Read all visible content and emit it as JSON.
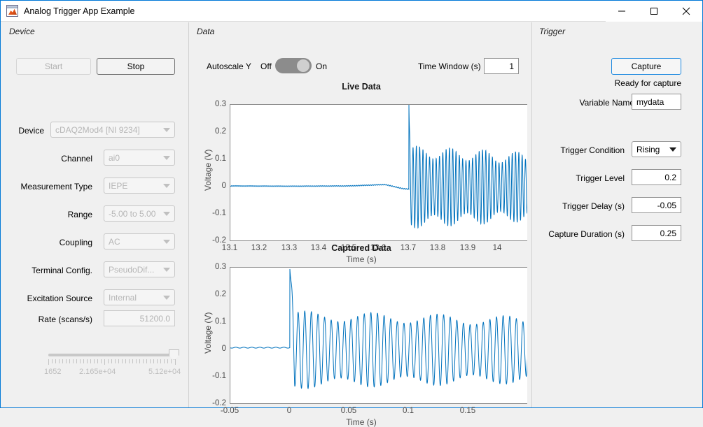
{
  "window": {
    "title": "Analog Trigger App Example",
    "icon": "matlab-app-icon",
    "minimize": "minimize-icon",
    "maximize": "maximize-icon",
    "close": "close-icon"
  },
  "device_panel": {
    "title": "Device",
    "start_label": "Start",
    "stop_label": "Stop",
    "fields": [
      {
        "label": "Device",
        "value": "cDAQ2Mod4 [NI 9234]"
      },
      {
        "label": "Channel",
        "value": "ai0"
      },
      {
        "label": "Measurement Type",
        "value": "IEPE"
      },
      {
        "label": "Range",
        "value": "-5.00 to 5.00"
      },
      {
        "label": "Coupling",
        "value": "AC"
      },
      {
        "label": "Terminal Config.",
        "value": "PseudoDif..."
      },
      {
        "label": "Excitation Source",
        "value": "Internal"
      }
    ],
    "rate_label": "Rate (scans/s)",
    "rate_value": "51200.0",
    "slider_ticks": [
      "1652",
      "2.165e+04",
      "5.12e+04"
    ]
  },
  "data_panel": {
    "title": "Data",
    "autoscale_label": "Autoscale Y",
    "autoscale_off": "Off",
    "autoscale_on": "On",
    "autoscale_state": "On",
    "time_window_label": "Time Window (s)",
    "time_window_value": "1"
  },
  "trigger_panel": {
    "title": "Trigger",
    "capture_label": "Capture",
    "status": "Ready for capture",
    "variable_name_label": "Variable Name",
    "variable_name_value": "mydata",
    "condition_label": "Trigger Condition",
    "condition_value": "Rising",
    "level_label": "Trigger Level",
    "level_value": "0.2",
    "delay_label": "Trigger Delay (s)",
    "delay_value": "-0.05",
    "duration_label": "Capture Duration (s)",
    "duration_value": "0.25"
  },
  "colors": {
    "accent": "#0072bd",
    "focus": "#1f8ae0",
    "panel_bg": "#f0f0f0"
  },
  "chart_data": [
    {
      "type": "line",
      "name": "live-data",
      "title": "Live Data",
      "xlabel": "Time (s)",
      "ylabel": "Voltage (V)",
      "xlim": [
        13.1,
        14.1
      ],
      "ylim": [
        -0.2,
        0.3
      ],
      "xticks": [
        13.1,
        13.2,
        13.3,
        13.4,
        13.5,
        13.6,
        13.7,
        13.8,
        13.9,
        14
      ],
      "xticklabels": [
        "13.1",
        "13.2",
        "13.3",
        "13.4",
        "13.5",
        "13.6",
        "13.7",
        "13.8",
        "13.9",
        "14"
      ],
      "yticks": [
        -0.2,
        -0.1,
        0,
        0.1,
        0.2,
        0.3
      ],
      "yticklabels": [
        "-0.2",
        "-0.1",
        "0",
        "0.1",
        "0.2",
        "0.3"
      ],
      "grid": false,
      "color": "#0072bd",
      "trigger_time": 13.7,
      "spike_value": 0.3,
      "baseline": 0.005,
      "oscillation": {
        "frequency_hz": 90,
        "amplitude_start": 0.13,
        "amplitude_end": 0.105,
        "beat_frequency_hz": 9,
        "beat_depth": 0.022
      },
      "pre_trigger_drift": [
        {
          "t": 13.1,
          "v": 0.004
        },
        {
          "t": 13.3,
          "v": 0.003
        },
        {
          "t": 13.5,
          "v": 0.004
        },
        {
          "t": 13.62,
          "v": 0.009
        },
        {
          "t": 13.68,
          "v": -0.006
        },
        {
          "t": 13.7,
          "v": -0.008
        }
      ]
    },
    {
      "type": "line",
      "name": "captured-data",
      "title": "Captured Data",
      "xlabel": "Time (s)",
      "ylabel": "Voltage (V)",
      "xlim": [
        -0.05,
        0.2
      ],
      "ylim": [
        -0.2,
        0.3
      ],
      "xticks": [
        -0.05,
        0,
        0.05,
        0.1,
        0.15
      ],
      "xticklabels": [
        "-0.05",
        "0",
        "0.05",
        "0.1",
        "0.15"
      ],
      "yticks": [
        -0.2,
        -0.1,
        0,
        0.1,
        0.2,
        0.3
      ],
      "yticklabels": [
        "-0.2",
        "-0.1",
        "0",
        "0.1",
        "0.2",
        "0.3"
      ],
      "grid": false,
      "color": "#0072bd",
      "trigger_time": 0,
      "spike_value": 0.295,
      "baseline": 0.008,
      "oscillation": {
        "frequency_hz": 180,
        "amplitude_start": 0.125,
        "amplitude_end": 0.105,
        "beat_frequency_hz": 18,
        "beat_depth": 0.018
      }
    }
  ]
}
